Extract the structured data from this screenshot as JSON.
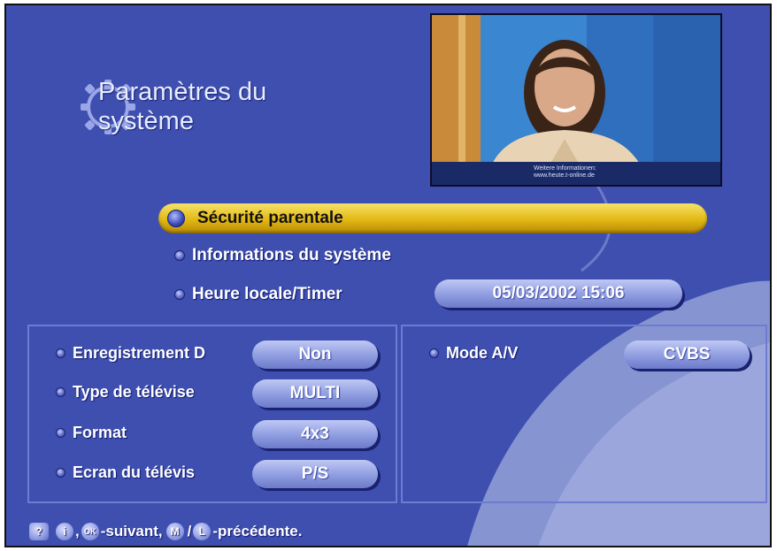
{
  "title": "Paramètres du système",
  "preview": {
    "ticker_line1": "Weitere Informationen:",
    "ticker_line2": "www.heute.t-online.de"
  },
  "menu": {
    "parental": "Sécurité parentale",
    "sysinfo": "Informations du système",
    "clock": "Heure locale/Timer",
    "clock_value": "05/03/2002 15:06"
  },
  "left_panel": {
    "rows": [
      {
        "label": "Enregistrement D",
        "value": "Non"
      },
      {
        "label": "Type de télévise",
        "value": "MULTI"
      },
      {
        "label": "Format",
        "value": "4x3"
      },
      {
        "label": "Ecran du télévis",
        "value": "P/S"
      }
    ]
  },
  "right_panel": {
    "rows": [
      {
        "label": "Mode A/V",
        "value": "CVBS"
      }
    ]
  },
  "footer": {
    "help_key": "?",
    "info_key": "i",
    "ok_key": "OK",
    "next_text": "-suivant,",
    "menu_key": "M",
    "separator": "/",
    "l_key": "L",
    "prev_text": "-précédente."
  },
  "colors": {
    "background": "#3e4fb0",
    "highlight": "#e2b712",
    "pill": "#8e9ce0"
  }
}
